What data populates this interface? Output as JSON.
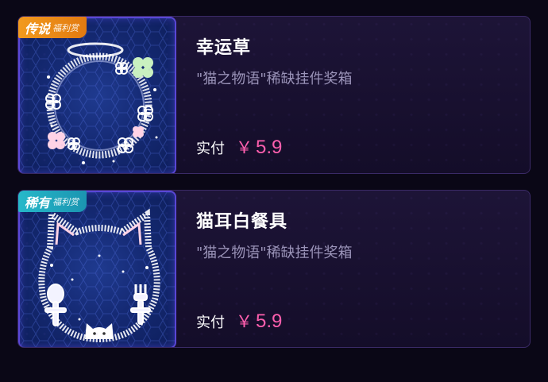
{
  "items": [
    {
      "badge_main": "传说",
      "badge_sub": "福利赏",
      "badge_style": "legend",
      "title": "幸运草",
      "description": "\"猫之物语\"稀缺挂件奖箱",
      "pay_label": "实付",
      "currency": "￥",
      "price": "5.9",
      "image_icon": "clover-ring-frame-icon"
    },
    {
      "badge_main": "稀有",
      "badge_sub": "福利赏",
      "badge_style": "rare",
      "title": "猫耳白餐具",
      "description": "\"猫之物语\"稀缺挂件奖箱",
      "pay_label": "实付",
      "currency": "￥",
      "price": "5.9",
      "image_icon": "cat-ear-tableware-frame-icon"
    }
  ],
  "colors": {
    "price": "#ff5fae",
    "legend_badge": "#f29a1e",
    "rare_badge": "#26b8c9",
    "thumb_border": "#5a47d6"
  }
}
